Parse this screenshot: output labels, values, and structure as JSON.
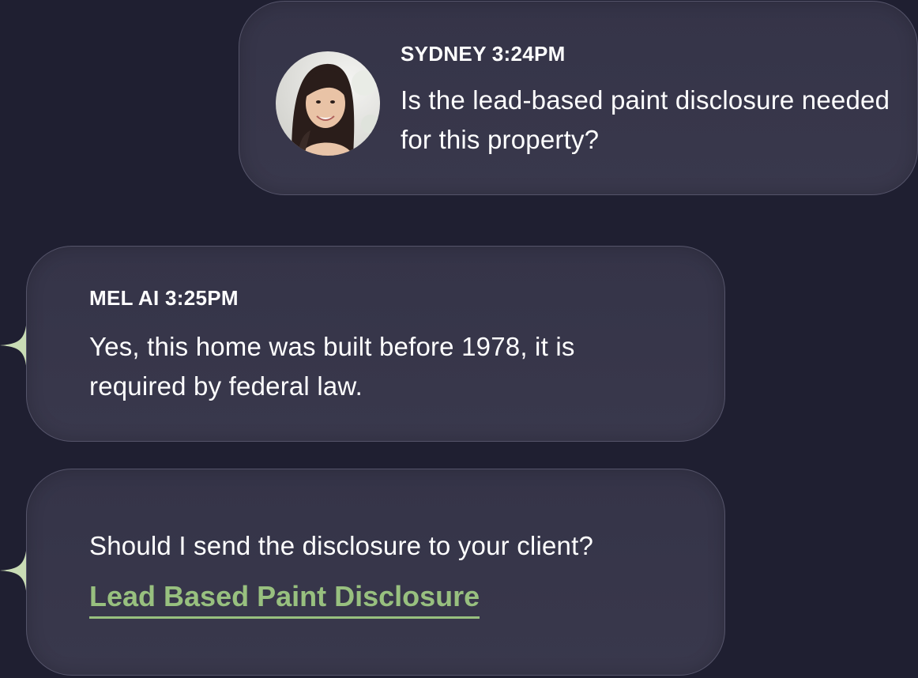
{
  "messages": [
    {
      "sender": "SYDNEY",
      "time": "3:24PM",
      "meta": "SYDNEY 3:24PM",
      "text": "Is the lead-based paint disclosure needed for this property?",
      "avatar": "user-photo-avatar"
    },
    {
      "sender": "MEL AI",
      "time": "3:25PM",
      "meta": "MEL AI 3:25PM",
      "text": "Yes, this home was built before 1978, it is required by federal law.",
      "icon": "sparkle-icon"
    },
    {
      "text": "Should I send the disclosure to your client?",
      "link_label": "Lead Based Paint Disclosure",
      "icon": "sparkle-icon"
    }
  ],
  "colors": {
    "background": "#1f1f31",
    "bubble": "#37364a",
    "bubble_border": "#55546a",
    "text": "#ffffff",
    "link": "#98c07f",
    "sparkle": "#c9dcb5"
  }
}
